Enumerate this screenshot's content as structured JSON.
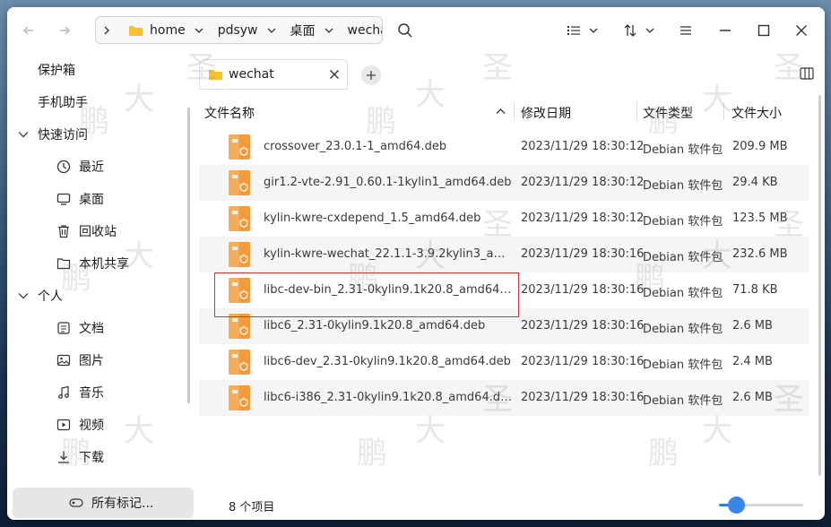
{
  "window": {
    "path": [
      "home",
      "pdsyw",
      "桌面",
      "wecha"
    ],
    "tab_label": "wechat"
  },
  "sidebar": {
    "top_items": [
      {
        "label": "保护箱",
        "icon": "safe-box"
      },
      {
        "label": "手机助手",
        "icon": "phone"
      }
    ],
    "quick_access": {
      "label": "快速访问",
      "items": [
        {
          "label": "最近",
          "icon": "clock-icon"
        },
        {
          "label": "桌面",
          "icon": "desktop-icon"
        },
        {
          "label": "回收站",
          "icon": "trash-icon"
        },
        {
          "label": "本机共享",
          "icon": "folder-share-icon"
        }
      ]
    },
    "personal": {
      "label": "个人",
      "items": [
        {
          "label": "文档",
          "icon": "document-icon"
        },
        {
          "label": "图片",
          "icon": "picture-icon"
        },
        {
          "label": "音乐",
          "icon": "music-icon"
        },
        {
          "label": "视频",
          "icon": "video-icon"
        },
        {
          "label": "下载",
          "icon": "download-icon"
        }
      ]
    },
    "all_marks": "所有标记..."
  },
  "table": {
    "columns": [
      "文件名称",
      "修改日期",
      "文件类型",
      "文件大小"
    ],
    "rows": [
      {
        "name": "crossover_23.0.1-1_amd64.deb",
        "date": "2023/11/29 18:30:12",
        "type": "Debian 软件包",
        "size": "209.9 MB"
      },
      {
        "name": "gir1.2-vte-2.91_0.60.1-1kylin1_amd64.deb",
        "date": "2023/11/29 18:30:12",
        "type": "Debian 软件包",
        "size": "29.4 KB"
      },
      {
        "name": "kylin-kwre-cxdepend_1.5_amd64.deb",
        "date": "2023/11/29 18:30:12",
        "type": "Debian 软件包",
        "size": "123.5 MB"
      },
      {
        "name": "kylin-kwre-wechat_22.1.1-3.9.2kylin3_amd…",
        "date": "2023/11/29 18:30:16",
        "type": "Debian 软件包",
        "size": "232.6 MB"
      },
      {
        "name": "libc-dev-bin_2.31-0kylin9.1k20.8_amd64.deb",
        "date": "2023/11/29 18:30:16",
        "type": "Debian 软件包",
        "size": "71.8 KB"
      },
      {
        "name": "libc6_2.31-0kylin9.1k20.8_amd64.deb",
        "date": "2023/11/29 18:30:16",
        "type": "Debian 软件包",
        "size": "2.6 MB"
      },
      {
        "name": "libc6-dev_2.31-0kylin9.1k20.8_amd64.deb",
        "date": "2023/11/29 18:30:16",
        "type": "Debian 软件包",
        "size": "2.4 MB"
      },
      {
        "name": "libc6-i386_2.31-0kylin9.1k20.8_amd64.deb",
        "date": "2023/11/29 18:30:16",
        "type": "Debian 软件包",
        "size": "2.6 MB"
      }
    ]
  },
  "status": {
    "count_text": "8 个项目",
    "zoom_fraction": 0.2
  },
  "colors": {
    "accent": "#3a86e8",
    "highlight_border": "#d9302f",
    "folder": "#f7c02f",
    "deb_icon": "#f39a3c"
  },
  "watermark": [
    "圣",
    "大",
    "鹏"
  ]
}
